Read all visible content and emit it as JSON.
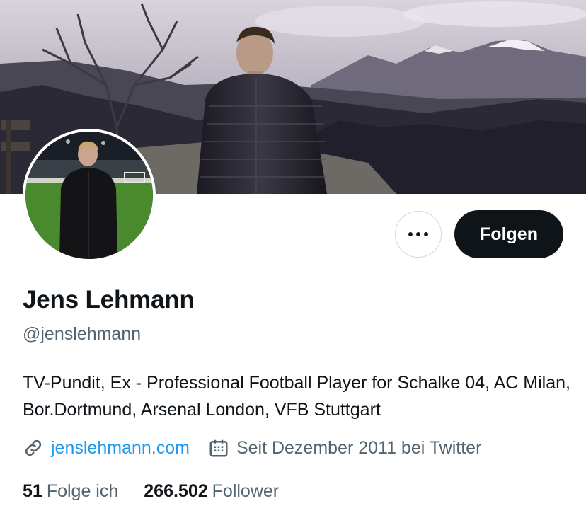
{
  "profile": {
    "name": "Jens Lehmann",
    "handle": "@jenslehmann",
    "bio": "TV-Pundit, Ex - Professional Football Player for Schalke 04, AC Milan, Bor.Dortmund, Arsenal London, VFB Stuttgart",
    "website": "jenslehmann.com",
    "joined": "Seit Dezember 2011 bei Twitter"
  },
  "actions": {
    "follow_label": "Folgen",
    "more_icon": "more-dots-icon"
  },
  "stats": {
    "following_count": "51",
    "following_label": "Folge ich",
    "followers_count": "266.502",
    "followers_label": "Follower"
  },
  "colors": {
    "link": "#1d9bf0",
    "secondary_text": "#536471",
    "follow_button_bg": "#0f1419"
  }
}
